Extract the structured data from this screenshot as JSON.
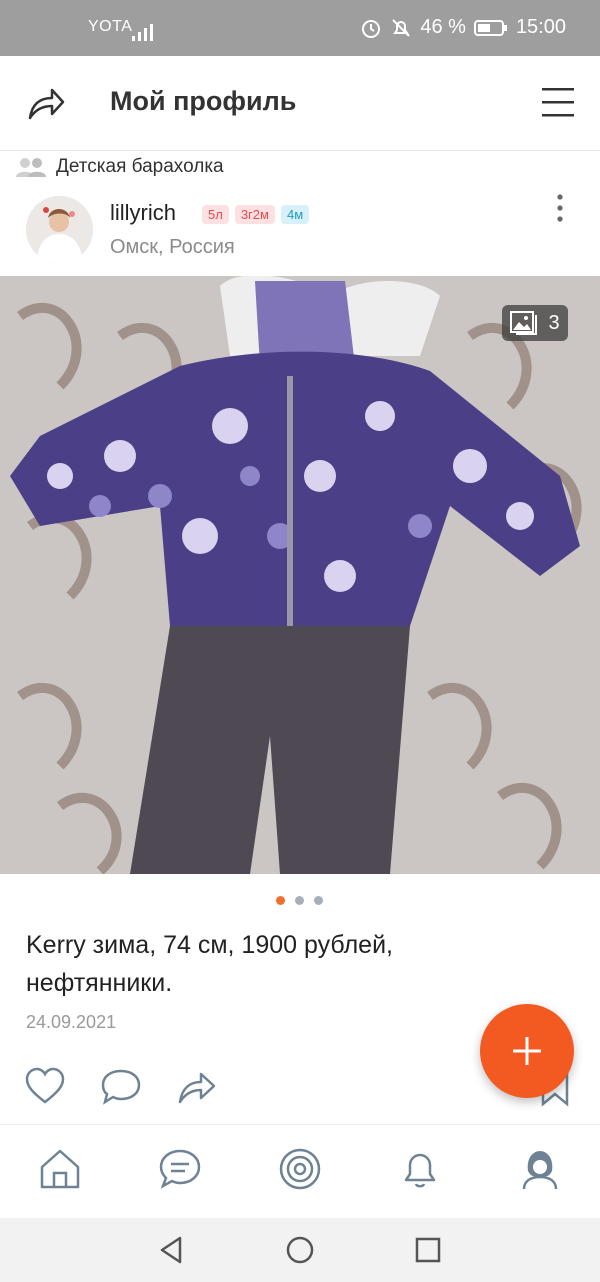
{
  "status_bar": {
    "carrier": "YOTA",
    "battery": "46 %",
    "time": "15:00"
  },
  "header": {
    "title": "Мой профиль"
  },
  "group": {
    "name": "Детская барахолка"
  },
  "author": {
    "name": "lillyrich",
    "badges": [
      "5л",
      "3г2м",
      "4м"
    ],
    "location": "Омск, Россия"
  },
  "photo": {
    "count": "3",
    "pager_dots": 3,
    "active_index": 0
  },
  "post": {
    "text": "Kerry зима, 74 см, 1900 рублей, нефтянники.",
    "date": "24.09.2021"
  },
  "colors": {
    "accent": "#f25a21",
    "status_bar": "#9e9e9e",
    "badge_pink": "#e24b50",
    "badge_blue": "#1f9cc7",
    "dot_active": "#f36e2c",
    "dot_inactive": "#a7b0ba"
  },
  "icons": {
    "header_left": "share-arrow-icon",
    "header_right": "hamburger-menu-icon",
    "group": "group-people-icon",
    "more": "more-vertical-icon",
    "photo_counter": "image-gallery-icon",
    "actions": [
      "heart-icon",
      "comment-icon",
      "share-icon",
      "bookmark-icon"
    ],
    "fab": "plus-icon",
    "nav": [
      "home-icon",
      "messages-icon",
      "discussions-icon",
      "notifications-icon",
      "profile-icon"
    ],
    "system": [
      "back-icon",
      "home-circle-icon",
      "recents-icon"
    ]
  }
}
